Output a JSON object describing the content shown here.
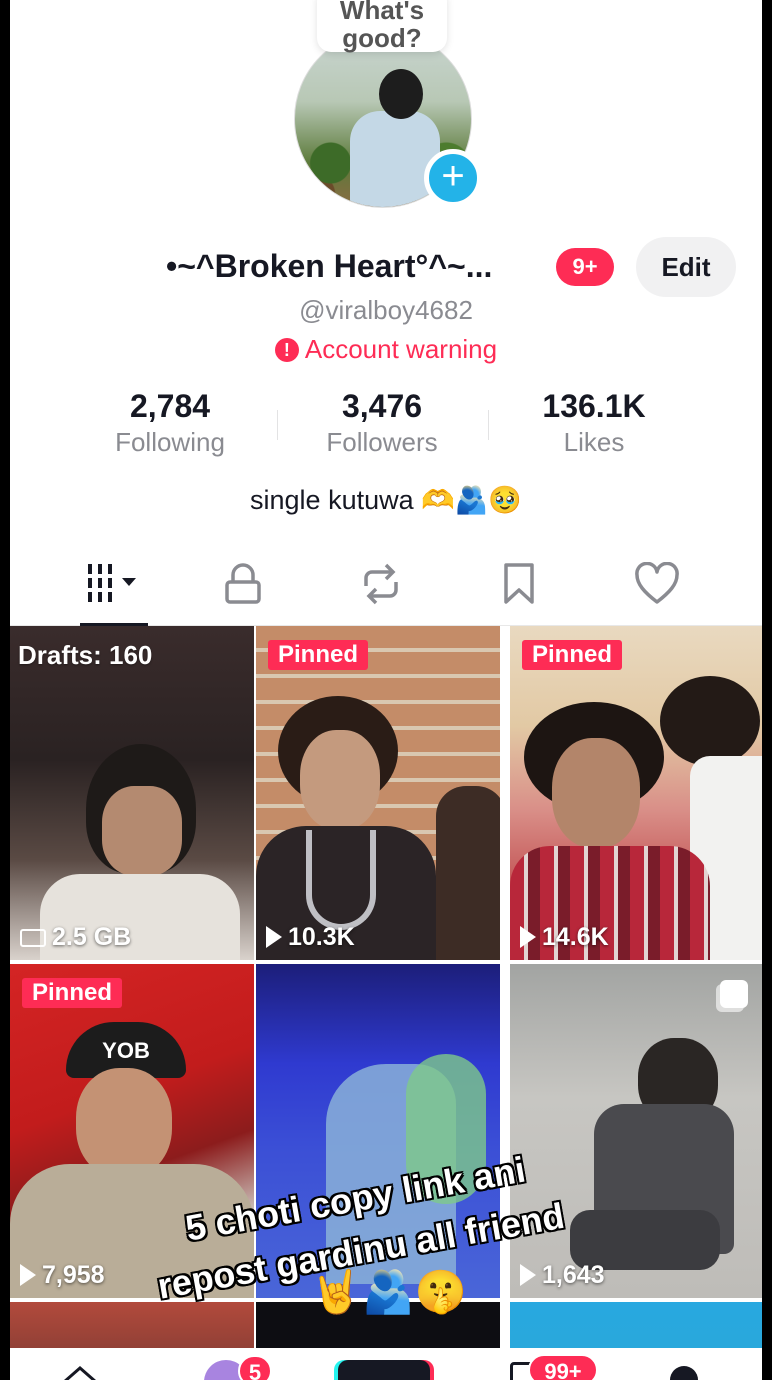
{
  "profile": {
    "note": "What's good?",
    "display_name": "•~^Broken Heart°^~...",
    "notifications_badge": "9+",
    "edit_label": "Edit",
    "username": "@viralboy4682",
    "warning": "Account warning",
    "warning_icon": "!",
    "bio": "single kutuwa 🫶🫂🥹"
  },
  "stats": [
    {
      "value": "2,784",
      "label": "Following"
    },
    {
      "value": "3,476",
      "label": "Followers"
    },
    {
      "value": "136.1K",
      "label": "Likes"
    }
  ],
  "tabs": [
    {
      "name": "videos-grid-icon"
    },
    {
      "name": "lock-icon"
    },
    {
      "name": "repost-icon"
    },
    {
      "name": "bookmark-icon"
    },
    {
      "name": "heart-icon"
    }
  ],
  "grid": {
    "drafts_label": "Drafts: 160",
    "drafts_size": "2.5 GB",
    "pinned_label": "Pinned",
    "views": [
      "10.3K",
      "14.6K",
      "7,958",
      "1,643"
    ]
  },
  "overlay": {
    "line1": "5 choti copy link ani",
    "line2": "repost gardinu all friend",
    "emoji": "🤘🫂🤫"
  },
  "bottom_nav": {
    "inbox_badge": "99+",
    "friends_badge": "5"
  },
  "colors": {
    "accent": "#fe2c55",
    "avatar_plus": "#23b3e8",
    "text_primary": "#161823",
    "text_secondary": "#8a8b91"
  }
}
